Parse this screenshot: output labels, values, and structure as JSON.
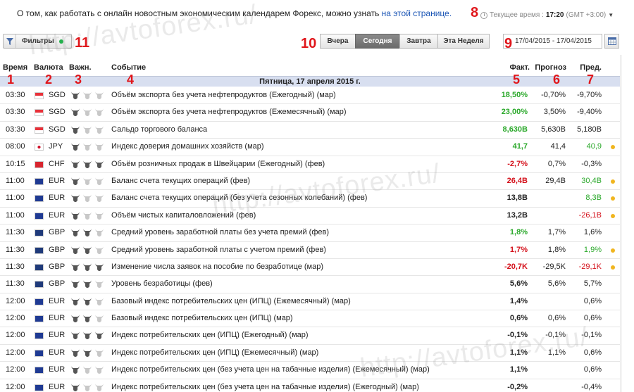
{
  "header": {
    "info_text": "О том, как работать с онлайн новостным экономическим календарем Форекс, можно узнать ",
    "info_link": "на этой странице.",
    "time_label": "Текущее время :",
    "time_value": "17:20",
    "timezone": "(GMT +3:00)"
  },
  "watermarks": [
    "http://avtoforex.ru/",
    "http://avtoforex.ru/",
    "http://avtoforex.ru/"
  ],
  "markers": [
    "1",
    "2",
    "3",
    "4",
    "5",
    "6",
    "7",
    "8",
    "9",
    "10",
    "11"
  ],
  "filters": {
    "label": "Фильтры"
  },
  "period_tabs": [
    {
      "label": "Вчера",
      "active": false
    },
    {
      "label": "Сегодня",
      "active": true
    },
    {
      "label": "Завтра",
      "active": false
    },
    {
      "label": "Эта Неделя",
      "active": false
    }
  ],
  "date_range": "17/04/2015 - 17/04/2015",
  "columns": {
    "time": "Время",
    "currency": "Валюта",
    "importance": "Важн.",
    "event": "Событие",
    "actual": "Факт.",
    "forecast": "Прогноз",
    "previous": "Пред."
  },
  "day_header": "Пятница, 17 апреля 2015 г.",
  "colors": {
    "green": "#2aa82a",
    "red": "#d4101a",
    "dot": "#f0b51f",
    "active_tab": "#777777"
  },
  "events": [
    {
      "time": "03:30",
      "flag": "sg",
      "currency": "SGD",
      "importance": 1,
      "event": "Объём экспорта без учета нефтепродуктов (Ежегодный) (мар)",
      "actual": "18,50%",
      "actual_color": "green",
      "forecast": "-0,70%",
      "previous": "-9,70%",
      "prev_color": "",
      "dot": false
    },
    {
      "time": "03:30",
      "flag": "sg",
      "currency": "SGD",
      "importance": 1,
      "event": "Объём экспорта без учета нефтепродуктов (Ежемесячный) (мар)",
      "actual": "23,00%",
      "actual_color": "green",
      "forecast": "3,50%",
      "previous": "-9,40%",
      "prev_color": "",
      "dot": false
    },
    {
      "time": "03:30",
      "flag": "sg",
      "currency": "SGD",
      "importance": 1,
      "event": "Сальдо торгового баланса",
      "actual": "8,630B",
      "actual_color": "green",
      "forecast": "5,630B",
      "previous": "5,180B",
      "prev_color": "",
      "dot": false
    },
    {
      "time": "08:00",
      "flag": "jp",
      "currency": "JPY",
      "importance": 1,
      "event": "Индекс доверия домашних хозяйств (мар)",
      "actual": "41,7",
      "actual_color": "green",
      "forecast": "41,4",
      "previous": "40,9",
      "prev_color": "green",
      "dot": true
    },
    {
      "time": "10:15",
      "flag": "ch",
      "currency": "CHF",
      "importance": 3,
      "event": "Объём розничных продаж в Швейцарии (Ежегодный) (фев)",
      "actual": "-2,7%",
      "actual_color": "red",
      "forecast": "0,7%",
      "previous": "-0,3%",
      "prev_color": "",
      "dot": false
    },
    {
      "time": "11:00",
      "flag": "eu",
      "currency": "EUR",
      "importance": 1,
      "event": "Баланс счета текущих операций (фев)",
      "actual": "26,4B",
      "actual_color": "red",
      "forecast": "29,4B",
      "previous": "30,4B",
      "prev_color": "green",
      "dot": true
    },
    {
      "time": "11:00",
      "flag": "eu",
      "currency": "EUR",
      "importance": 1,
      "event": "Баланс счета текущих операций (без учета сезонных колебаний) (фев)",
      "actual": "13,8B",
      "actual_color": "",
      "forecast": "",
      "previous": "8,3B",
      "prev_color": "green",
      "dot": true
    },
    {
      "time": "11:00",
      "flag": "eu",
      "currency": "EUR",
      "importance": 1,
      "event": "Объём чистых капиталовложений (фев)",
      "actual": "13,2B",
      "actual_color": "",
      "forecast": "",
      "previous": "-26,1B",
      "prev_color": "red",
      "dot": true
    },
    {
      "time": "11:30",
      "flag": "gb",
      "currency": "GBP",
      "importance": 2,
      "event": "Средний уровень заработной платы без учета премий (фев)",
      "actual": "1,8%",
      "actual_color": "green",
      "forecast": "1,7%",
      "previous": "1,6%",
      "prev_color": "",
      "dot": false
    },
    {
      "time": "11:30",
      "flag": "gb",
      "currency": "GBP",
      "importance": 2,
      "event": "Средний уровень заработной платы с учетом премий (фев)",
      "actual": "1,7%",
      "actual_color": "red",
      "forecast": "1,8%",
      "previous": "1,9%",
      "prev_color": "green",
      "dot": true
    },
    {
      "time": "11:30",
      "flag": "gb",
      "currency": "GBP",
      "importance": 3,
      "event": "Изменение числа заявок на пособие по безработице (мар)",
      "actual": "-20,7K",
      "actual_color": "red",
      "forecast": "-29,5K",
      "previous": "-29,1K",
      "prev_color": "red",
      "dot": true
    },
    {
      "time": "11:30",
      "flag": "gb",
      "currency": "GBP",
      "importance": 2,
      "event": "Уровень безработицы (фев)",
      "actual": "5,6%",
      "actual_color": "",
      "forecast": "5,6%",
      "previous": "5,7%",
      "prev_color": "",
      "dot": false
    },
    {
      "time": "12:00",
      "flag": "eu",
      "currency": "EUR",
      "importance": 2,
      "event": "Базовый индекс потребительских цен (ИПЦ) (Ежемесячный) (мар)",
      "actual": "1,4%",
      "actual_color": "",
      "forecast": "",
      "previous": "0,6%",
      "prev_color": "",
      "dot": false
    },
    {
      "time": "12:00",
      "flag": "eu",
      "currency": "EUR",
      "importance": 2,
      "event": "Базовый индекс потребительских цен (ИПЦ) (мар)",
      "actual": "0,6%",
      "actual_color": "",
      "forecast": "0,6%",
      "previous": "0,6%",
      "prev_color": "",
      "dot": false
    },
    {
      "time": "12:00",
      "flag": "eu",
      "currency": "EUR",
      "importance": 3,
      "event": "Индекс потребительских цен (ИПЦ) (Ежегодный) (мар)",
      "actual": "-0,1%",
      "actual_color": "",
      "forecast": "-0,1%",
      "previous": "-0,1%",
      "prev_color": "",
      "dot": false
    },
    {
      "time": "12:00",
      "flag": "eu",
      "currency": "EUR",
      "importance": 2,
      "event": "Индекс потребительских цен (ИПЦ) (Ежемесячный) (мар)",
      "actual": "1,1%",
      "actual_color": "",
      "forecast": "1,1%",
      "previous": "0,6%",
      "prev_color": "",
      "dot": false
    },
    {
      "time": "12:00",
      "flag": "eu",
      "currency": "EUR",
      "importance": 1,
      "event": "Индекс потребительских цен (без учета цен на табачные изделия) (Ежемесячный) (мар)",
      "actual": "1,1%",
      "actual_color": "",
      "forecast": "",
      "previous": "0,6%",
      "prev_color": "",
      "dot": false
    },
    {
      "time": "12:00",
      "flag": "eu",
      "currency": "EUR",
      "importance": 1,
      "event": "Индекс потребительских цен (без учета цен на табачные изделия) (Ежегодный) (мар)",
      "actual": "-0,2%",
      "actual_color": "",
      "forecast": "",
      "previous": "-0,4%",
      "prev_color": "",
      "dot": false
    }
  ]
}
